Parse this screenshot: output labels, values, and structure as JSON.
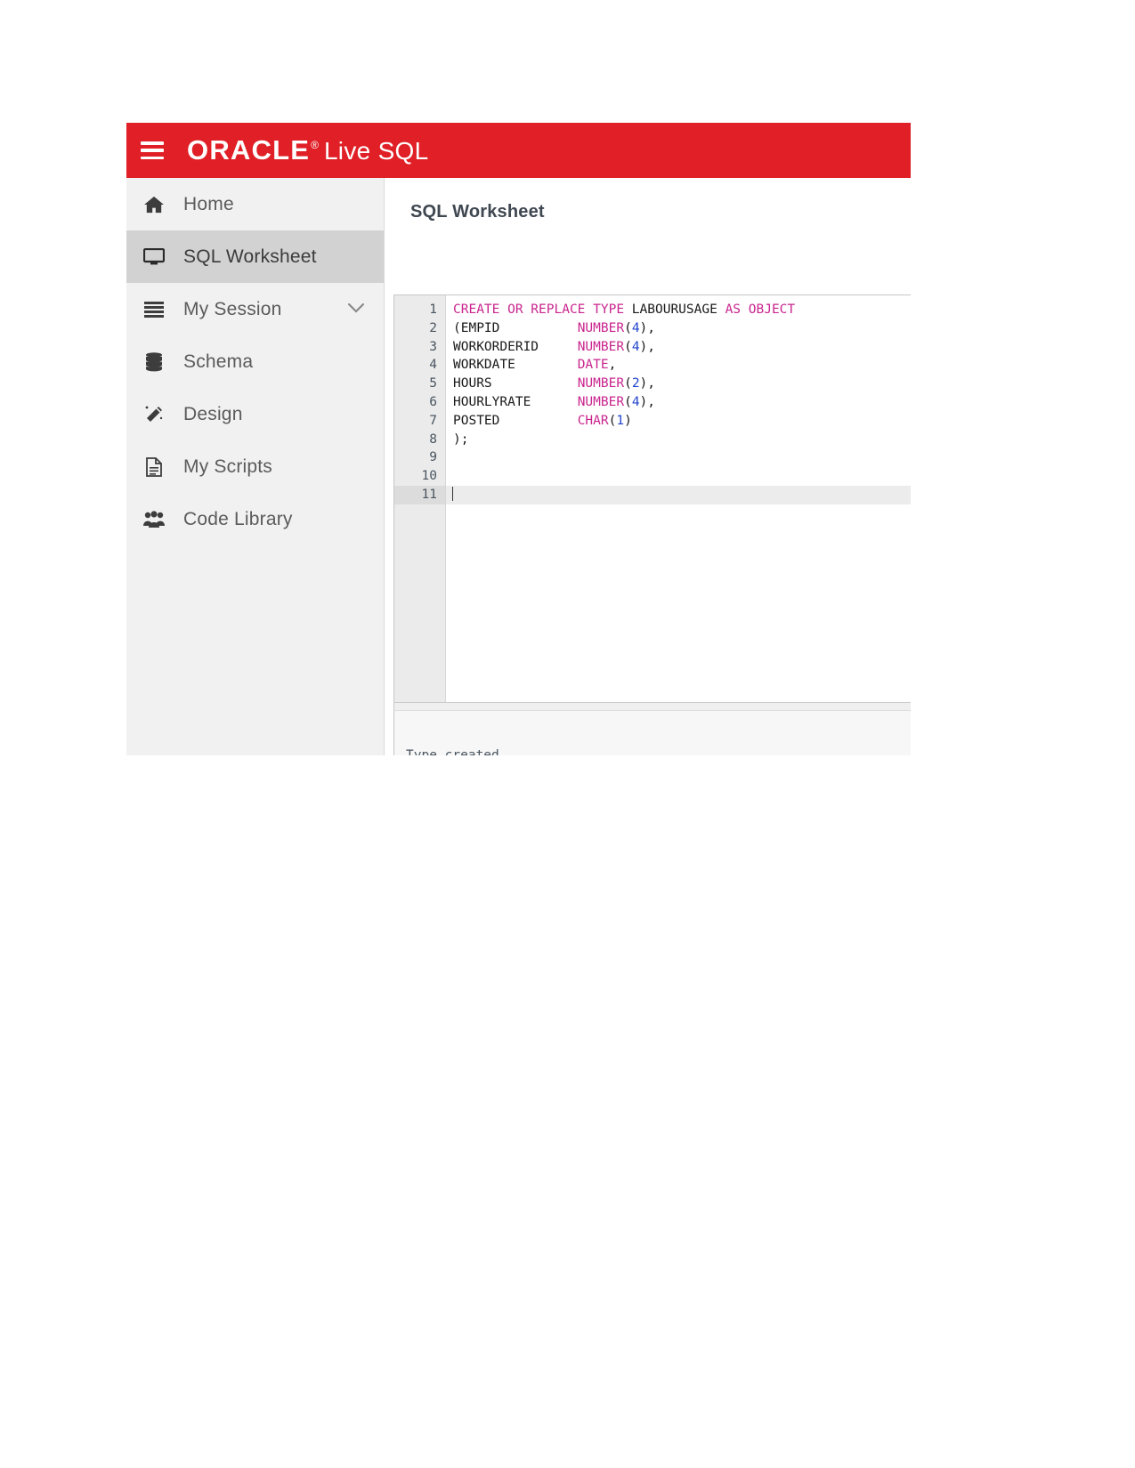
{
  "header": {
    "menu_icon": "hamburger-icon",
    "brand_oracle": "ORACLE",
    "brand_reg": "®",
    "brand_product": "Live SQL",
    "brand_bg_color": "#e01f26"
  },
  "sidebar": {
    "items": [
      {
        "label": "Home",
        "icon": "home-icon",
        "active": false,
        "has_chevron": false
      },
      {
        "label": "SQL Worksheet",
        "icon": "monitor-icon",
        "active": true,
        "has_chevron": false
      },
      {
        "label": "My Session",
        "icon": "list-icon",
        "active": false,
        "has_chevron": true
      },
      {
        "label": "Schema",
        "icon": "database-icon",
        "active": false,
        "has_chevron": false
      },
      {
        "label": "Design",
        "icon": "wand-icon",
        "active": false,
        "has_chevron": false
      },
      {
        "label": "My Scripts",
        "icon": "document-icon",
        "active": false,
        "has_chevron": false
      },
      {
        "label": "Code Library",
        "icon": "users-icon",
        "active": false,
        "has_chevron": false
      }
    ]
  },
  "main": {
    "title": "SQL Worksheet"
  },
  "editor": {
    "active_line": 11,
    "line_numbers": [
      "1",
      "2",
      "3",
      "4",
      "5",
      "6",
      "7",
      "8",
      "9",
      "10",
      "11"
    ],
    "lines": [
      {
        "n": "1",
        "tokens": [
          {
            "t": "CREATE OR REPLACE TYPE ",
            "c": "kw"
          },
          {
            "t": "LABOURUSAGE ",
            "c": "pun"
          },
          {
            "t": "AS OBJECT",
            "c": "kw"
          }
        ]
      },
      {
        "n": "2",
        "tokens": [
          {
            "t": "(EMPID          ",
            "c": "pun"
          },
          {
            "t": "NUMBER",
            "c": "kw"
          },
          {
            "t": "(",
            "c": "pun"
          },
          {
            "t": "4",
            "c": "num"
          },
          {
            "t": "),",
            "c": "pun"
          }
        ]
      },
      {
        "n": "3",
        "tokens": [
          {
            "t": "WORKORDERID     ",
            "c": "pun"
          },
          {
            "t": "NUMBER",
            "c": "kw"
          },
          {
            "t": "(",
            "c": "pun"
          },
          {
            "t": "4",
            "c": "num"
          },
          {
            "t": "),",
            "c": "pun"
          }
        ]
      },
      {
        "n": "4",
        "tokens": [
          {
            "t": "WORKDATE        ",
            "c": "pun"
          },
          {
            "t": "DATE",
            "c": "kw"
          },
          {
            "t": ",",
            "c": "pun"
          }
        ]
      },
      {
        "n": "5",
        "tokens": [
          {
            "t": "HOURS           ",
            "c": "pun"
          },
          {
            "t": "NUMBER",
            "c": "kw"
          },
          {
            "t": "(",
            "c": "pun"
          },
          {
            "t": "2",
            "c": "num"
          },
          {
            "t": "),",
            "c": "pun"
          }
        ]
      },
      {
        "n": "6",
        "tokens": [
          {
            "t": "HOURLYRATE      ",
            "c": "pun"
          },
          {
            "t": "NUMBER",
            "c": "kw"
          },
          {
            "t": "(",
            "c": "pun"
          },
          {
            "t": "4",
            "c": "num"
          },
          {
            "t": "),",
            "c": "pun"
          }
        ]
      },
      {
        "n": "7",
        "tokens": [
          {
            "t": "POSTED          ",
            "c": "pun"
          },
          {
            "t": "CHAR",
            "c": "kw"
          },
          {
            "t": "(",
            "c": "pun"
          },
          {
            "t": "1",
            "c": "num"
          },
          {
            "t": ")",
            "c": "pun"
          }
        ]
      },
      {
        "n": "8",
        "tokens": [
          {
            "t": ");",
            "c": "pun"
          }
        ]
      },
      {
        "n": "9",
        "tokens": []
      },
      {
        "n": "10",
        "tokens": []
      },
      {
        "n": "11",
        "tokens": []
      }
    ],
    "raw_sql": "CREATE OR REPLACE TYPE LABOURUSAGE AS OBJECT\n(EMPID          NUMBER(4),\nWORKORDERID     NUMBER(4),\nWORKDATE        DATE,\nHOURS           NUMBER(2),\nHOURLYRATE      NUMBER(4),\nPOSTED          CHAR(1)\n);",
    "keyword_color": "#c9258e",
    "number_color": "#2244cc"
  },
  "output": {
    "message": "Type created."
  }
}
